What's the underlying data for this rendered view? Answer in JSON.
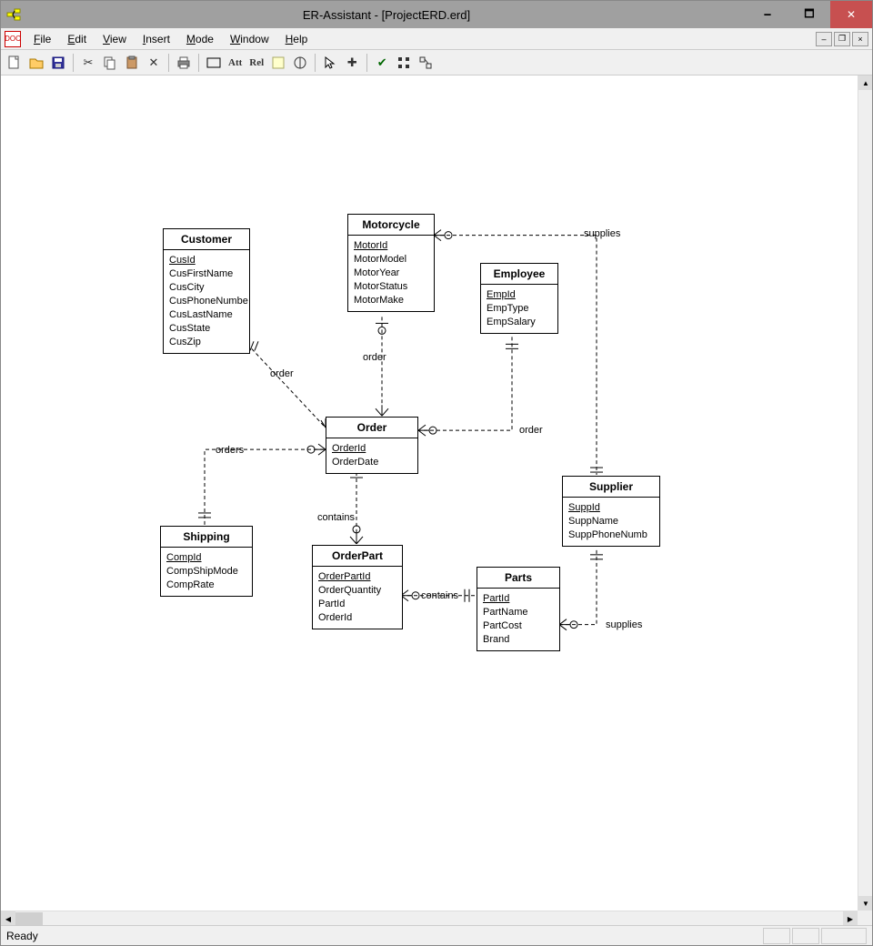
{
  "window": {
    "title": "ER-Assistant - [ProjectERD.erd]"
  },
  "menu": {
    "file": "File",
    "edit": "Edit",
    "view": "View",
    "insert": "Insert",
    "mode": "Mode",
    "window": "Window",
    "help": "Help"
  },
  "toolbar": {
    "att": "Att",
    "rel": "Rel"
  },
  "status": {
    "text": "Ready"
  },
  "entities": {
    "customer": {
      "title": "Customer",
      "pk": "CusId",
      "attrs": "CusFirstName\nCusCity\nCusPhoneNumbe\nCusLastName\nCusState\nCusZip"
    },
    "motorcycle": {
      "title": "Motorcycle",
      "pk": "MotorId",
      "attrs": "MotorModel\nMotorYear\nMotorStatus\nMotorMake"
    },
    "employee": {
      "title": "Employee",
      "pk": "EmpId",
      "attrs": "EmpType\nEmpSalary"
    },
    "order": {
      "title": "Order",
      "pk": "OrderId",
      "attrs": "OrderDate"
    },
    "shipping": {
      "title": "Shipping",
      "pk": "CompId",
      "attrs": "CompShipMode\nCompRate"
    },
    "orderpart": {
      "title": "OrderPart",
      "pk": "OrderPartId",
      "attrs": "OrderQuantity\nPartId\nOrderId"
    },
    "parts": {
      "title": "Parts",
      "pk": "PartId",
      "attrs": "PartName\nPartCost\nBrand"
    },
    "supplier": {
      "title": "Supplier",
      "pk": "SuppId",
      "attrs": "SuppName\nSuppPhoneNumb"
    }
  },
  "relationships": {
    "cust_order": "order",
    "motor_order_top": "order",
    "emp_order": "order",
    "ship_order": "orders",
    "order_part_contains": "contains",
    "orderpart_parts": "contains",
    "motor_supplier": "supplies",
    "parts_supplier": "supplies"
  }
}
